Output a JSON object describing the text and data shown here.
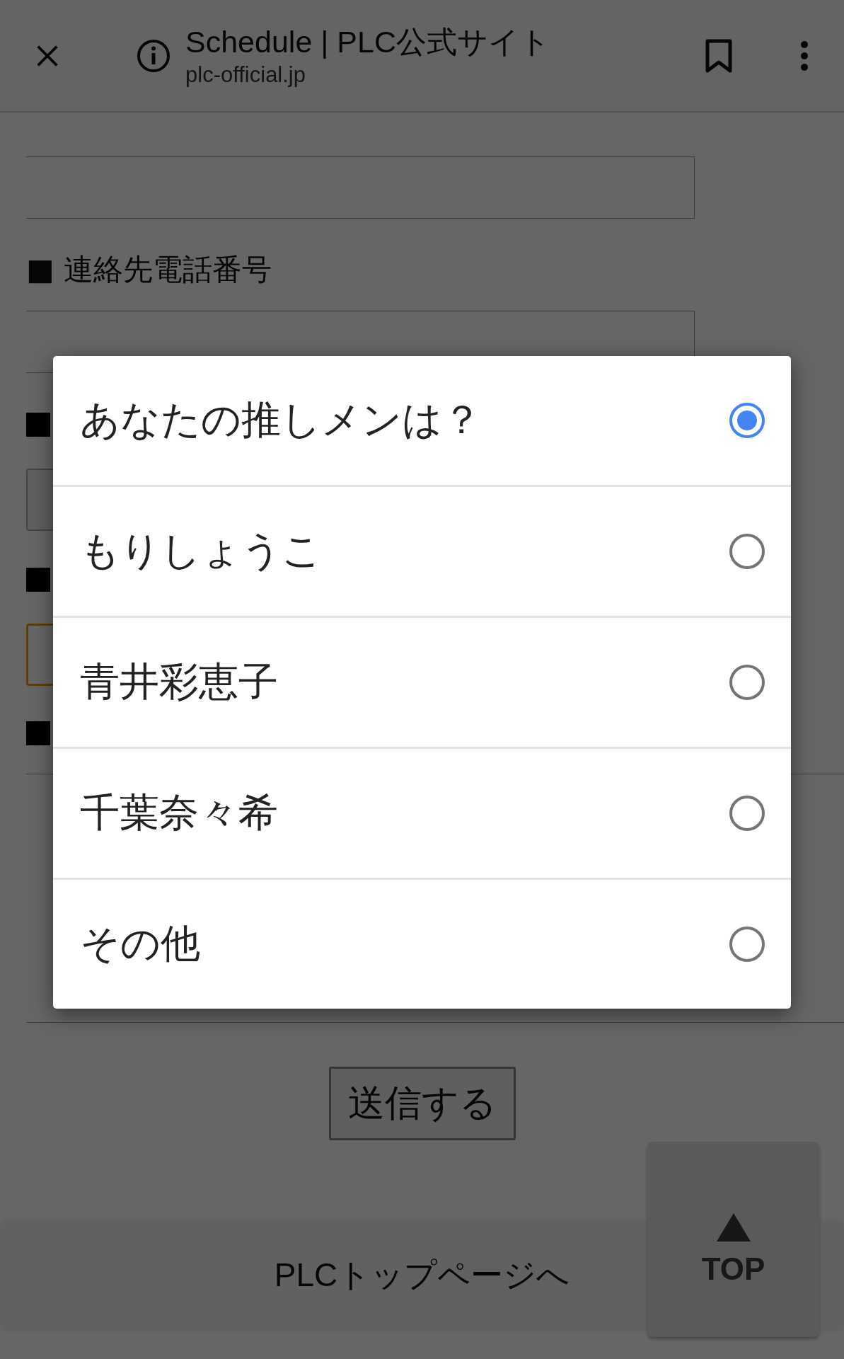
{
  "browser": {
    "title": "Schedule | PLC公式サイト",
    "url": "plc-official.jp"
  },
  "form": {
    "phone_label": "■ 連絡先電話番号",
    "submit": "送信する"
  },
  "dialog": {
    "options": [
      {
        "label": "あなたの推しメンは？",
        "selected": true
      },
      {
        "label": "もりしょうこ",
        "selected": false
      },
      {
        "label": "青井彩恵子",
        "selected": false
      },
      {
        "label": "千葉奈々希",
        "selected": false
      },
      {
        "label": "その他",
        "selected": false
      }
    ]
  },
  "footer": {
    "link": "PLCトップページへ",
    "top_button": "TOP"
  }
}
